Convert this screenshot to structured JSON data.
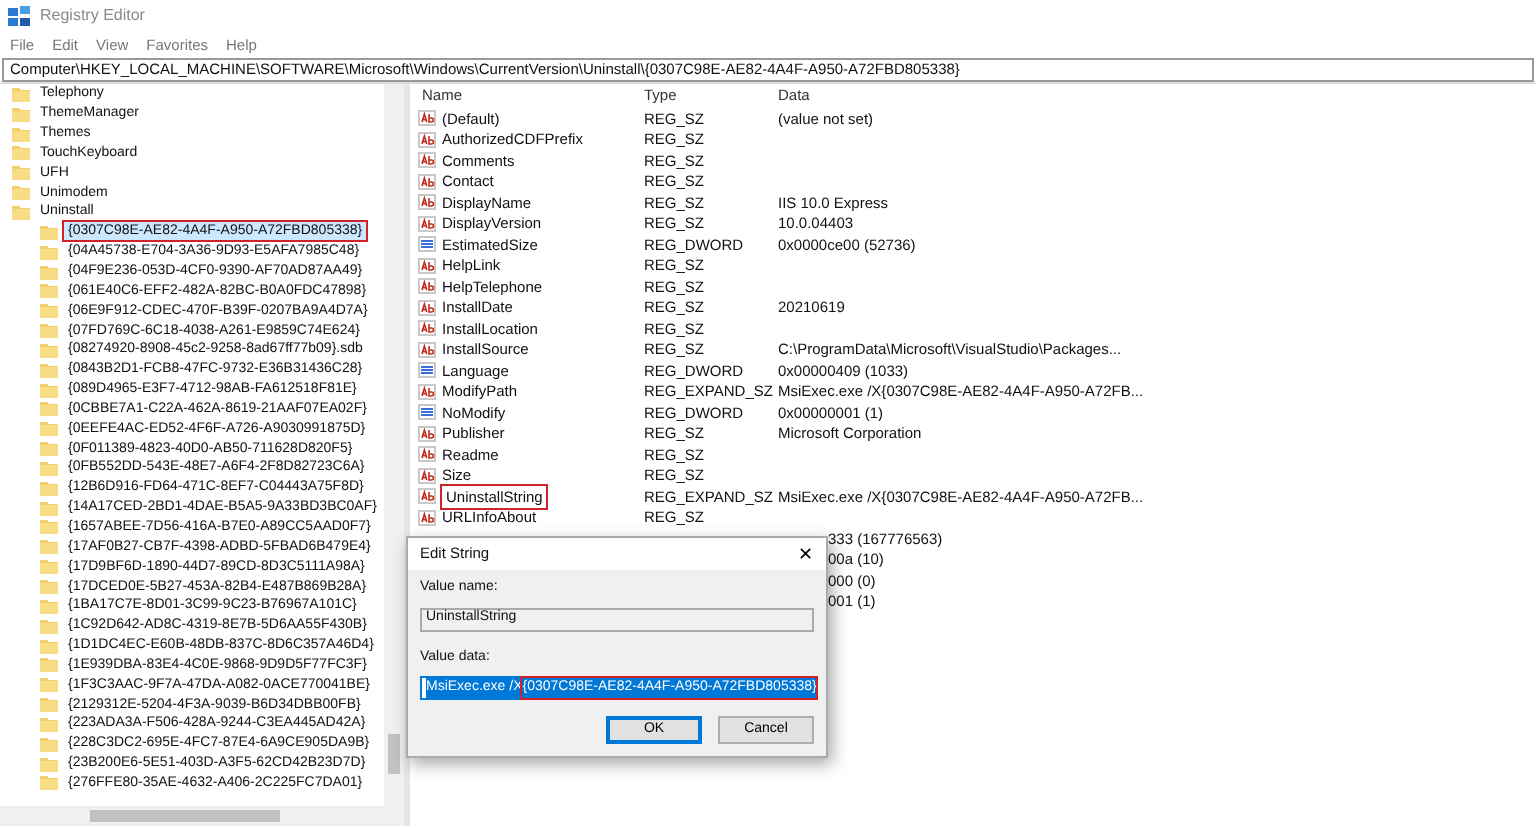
{
  "window": {
    "title": "Registry Editor"
  },
  "menu": [
    "File",
    "Edit",
    "View",
    "Favorites",
    "Help"
  ],
  "address": "Computer\\HKEY_LOCAL_MACHINE\\SOFTWARE\\Microsoft\\Windows\\CurrentVersion\\Uninstall\\{0307C98E-AE82-4A4F-A950-A72FBD805338}",
  "tree": [
    {
      "label": "Telephony",
      "selected": false,
      "highlighted": false
    },
    {
      "label": "ThemeManager",
      "selected": false,
      "highlighted": false
    },
    {
      "label": "Themes",
      "selected": false,
      "highlighted": false
    },
    {
      "label": "TouchKeyboard",
      "selected": false,
      "highlighted": false
    },
    {
      "label": "UFH",
      "selected": false,
      "highlighted": false
    },
    {
      "label": "Unimodem",
      "selected": false,
      "highlighted": false
    },
    {
      "label": "Uninstall",
      "selected": false,
      "highlighted": false,
      "children": [
        {
          "label": "{0307C98E-AE82-4A4F-A950-A72FBD805338}",
          "selected": true,
          "highlighted": true
        },
        {
          "label": "{04A45738-E704-3A36-9D93-E5AFA7985C48}",
          "selected": false,
          "highlighted": false
        },
        {
          "label": "{04F9E236-053D-4CF0-9390-AF70AD87AA49}",
          "selected": false,
          "highlighted": false
        },
        {
          "label": "{061E40C6-EFF2-482A-82BC-B0A0FDC47898}",
          "selected": false,
          "highlighted": false
        },
        {
          "label": "{06E9F912-CDEC-470F-B39F-0207BA9A4D7A}",
          "selected": false,
          "highlighted": false
        },
        {
          "label": "{07FD769C-6C18-4038-A261-E9859C74E624}",
          "selected": false,
          "highlighted": false
        },
        {
          "label": "{08274920-8908-45c2-9258-8ad67ff77b09}.sdb",
          "selected": false,
          "highlighted": false
        },
        {
          "label": "{0843B2D1-FCB8-47FC-9732-E36B31436C28}",
          "selected": false,
          "highlighted": false
        },
        {
          "label": "{089D4965-E3F7-4712-98AB-FA612518F81E}",
          "selected": false,
          "highlighted": false
        },
        {
          "label": "{0CBBE7A1-C22A-462A-8619-21AAF07EA02F}",
          "selected": false,
          "highlighted": false
        },
        {
          "label": "{0EEFE4AC-ED52-4F6F-A726-A9030991875D}",
          "selected": false,
          "highlighted": false
        },
        {
          "label": "{0F011389-4823-40D0-AB50-711628D820F5}",
          "selected": false,
          "highlighted": false
        },
        {
          "label": "{0FB552DD-543E-48E7-A6F4-2F8D82723C6A}",
          "selected": false,
          "highlighted": false
        },
        {
          "label": "{12B6D916-FD64-471C-8EF7-C04443A75F8D}",
          "selected": false,
          "highlighted": false
        },
        {
          "label": "{14A17CED-2BD1-4DAE-B5A5-9A33BD3BC0AF}",
          "selected": false,
          "highlighted": false
        },
        {
          "label": "{1657ABEE-7D56-416A-B7E0-A89CC5AAD0F7}",
          "selected": false,
          "highlighted": false
        },
        {
          "label": "{17AF0B27-CB7F-4398-ADBD-5FBAD6B479E4}",
          "selected": false,
          "highlighted": false
        },
        {
          "label": "{17D9BF6D-1890-44D7-89CD-8D3C5111A98A}",
          "selected": false,
          "highlighted": false
        },
        {
          "label": "{17DCED0E-5B27-453A-82B4-E487B869B28A}",
          "selected": false,
          "highlighted": false
        },
        {
          "label": "{1BA17C7E-8D01-3C99-9C23-B76967A101C}",
          "selected": false,
          "highlighted": false
        },
        {
          "label": "{1C92D642-AD8C-4319-8E7B-5D6AA55F430B}",
          "selected": false,
          "highlighted": false
        },
        {
          "label": "{1D1DC4EC-E60B-48DB-837C-8D6C357A46D4}",
          "selected": false,
          "highlighted": false
        },
        {
          "label": "{1E939DBA-83E4-4C0E-9868-9D9D5F77FC3F}",
          "selected": false,
          "highlighted": false
        },
        {
          "label": "{1F3C3AAC-9F7A-47DA-A082-0ACE770041BE}",
          "selected": false,
          "highlighted": false
        },
        {
          "label": "{2129312E-5204-4F3A-9039-B6D34DBB00FB}",
          "selected": false,
          "highlighted": false
        },
        {
          "label": "{223ADA3A-F506-428A-9244-C3EA445AD42A}",
          "selected": false,
          "highlighted": false
        },
        {
          "label": "{228C3DC2-695E-4FC7-87E4-6A9CE905DA9B}",
          "selected": false,
          "highlighted": false
        },
        {
          "label": "{23B200E6-5E51-403D-A3F5-62CD42B23D7D}",
          "selected": false,
          "highlighted": false
        },
        {
          "label": "{276FFE80-35AE-4632-A406-2C225FC7DA01}",
          "selected": false,
          "highlighted": false
        }
      ]
    }
  ],
  "values": {
    "columns": [
      "Name",
      "Type",
      "Data"
    ],
    "rows": [
      {
        "kind": "string",
        "name": "(Default)",
        "type": "REG_SZ",
        "data": "(value not set)",
        "highlighted": false
      },
      {
        "kind": "string",
        "name": "AuthorizedCDFPrefix",
        "type": "REG_SZ",
        "data": "",
        "highlighted": false
      },
      {
        "kind": "string",
        "name": "Comments",
        "type": "REG_SZ",
        "data": "",
        "highlighted": false
      },
      {
        "kind": "string",
        "name": "Contact",
        "type": "REG_SZ",
        "data": "",
        "highlighted": false
      },
      {
        "kind": "string",
        "name": "DisplayName",
        "type": "REG_SZ",
        "data": "IIS 10.0 Express",
        "highlighted": false
      },
      {
        "kind": "string",
        "name": "DisplayVersion",
        "type": "REG_SZ",
        "data": "10.0.04403",
        "highlighted": false
      },
      {
        "kind": "dword",
        "name": "EstimatedSize",
        "type": "REG_DWORD",
        "data": "0x0000ce00 (52736)",
        "highlighted": false
      },
      {
        "kind": "string",
        "name": "HelpLink",
        "type": "REG_SZ",
        "data": "",
        "highlighted": false
      },
      {
        "kind": "string",
        "name": "HelpTelephone",
        "type": "REG_SZ",
        "data": "",
        "highlighted": false
      },
      {
        "kind": "string",
        "name": "InstallDate",
        "type": "REG_SZ",
        "data": "20210619",
        "highlighted": false
      },
      {
        "kind": "string",
        "name": "InstallLocation",
        "type": "REG_SZ",
        "data": "",
        "highlighted": false
      },
      {
        "kind": "string",
        "name": "InstallSource",
        "type": "REG_SZ",
        "data": "C:\\ProgramData\\Microsoft\\VisualStudio\\Packages...",
        "highlighted": false
      },
      {
        "kind": "dword",
        "name": "Language",
        "type": "REG_DWORD",
        "data": "0x00000409 (1033)",
        "highlighted": false
      },
      {
        "kind": "string",
        "name": "ModifyPath",
        "type": "REG_EXPAND_SZ",
        "data": "MsiExec.exe /X{0307C98E-AE82-4A4F-A950-A72FB...",
        "highlighted": false
      },
      {
        "kind": "dword",
        "name": "NoModify",
        "type": "REG_DWORD",
        "data": "0x00000001 (1)",
        "highlighted": false
      },
      {
        "kind": "string",
        "name": "Publisher",
        "type": "REG_SZ",
        "data": "Microsoft Corporation",
        "highlighted": false
      },
      {
        "kind": "string",
        "name": "Readme",
        "type": "REG_SZ",
        "data": "",
        "highlighted": false
      },
      {
        "kind": "string",
        "name": "Size",
        "type": "REG_SZ",
        "data": "",
        "highlighted": false
      },
      {
        "kind": "string",
        "name": "UninstallString",
        "type": "REG_EXPAND_SZ",
        "data": "MsiExec.exe /X{0307C98E-AE82-4A4F-A950-A72FB...",
        "highlighted": true
      },
      {
        "kind": "string",
        "name": "URLInfoAbout",
        "type": "REG_SZ",
        "data": "",
        "highlighted": false
      },
      {
        "kind": "partial",
        "data": "333 (167776563)"
      },
      {
        "kind": "partial",
        "data": "00a (10)"
      },
      {
        "kind": "partial",
        "data": "000 (0)"
      },
      {
        "kind": "partial",
        "data": "001 (1)"
      }
    ]
  },
  "dialog": {
    "title": "Edit String",
    "close": "✕",
    "name_label": "Value name:",
    "name_value": "UninstallString",
    "data_label": "Value data:",
    "data_prefix": "MsiExec.exe /X",
    "data_highlighted": "{0307C98E-AE82-4A4F-A950-A72FBD805338}",
    "buttons": [
      {
        "label": "OK",
        "default": true
      },
      {
        "label": "Cancel",
        "default": false
      }
    ]
  }
}
